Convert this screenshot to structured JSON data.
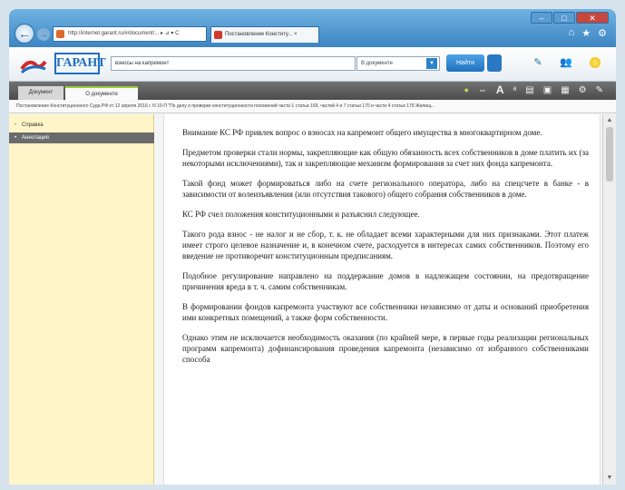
{
  "browser": {
    "address": "http://internet.garant.ru/#/document/... ▸ ⊿ ▾ C",
    "tab_title": "Постановление Конститу... ×",
    "window_controls": [
      "–",
      "□",
      "✕"
    ],
    "icons": [
      "home-icon",
      "star-icon",
      "gear-icon"
    ]
  },
  "toolbar": {
    "logo_text": "ГАРАНТ",
    "search_value": "взносы на капремонт",
    "scope_value": "В документе",
    "find_label": "Найти"
  },
  "doc_tabs": [
    "Документ",
    "О документе"
  ],
  "breadcrumb": "Постановление Конституционного Суда РФ от 12 апреля 2016 г. N 10-П \"По делу о проверке конституционности положений части 1 статьи 169, частей 4 и 7 статьи 170 и части 4 статьи 179 Жилищ...",
  "sidebar": {
    "items": [
      "Справка",
      "Аннотация"
    ]
  },
  "paragraphs": [
    "Внимание КС РФ привлек вопрос о взносах на капремонт общего имущества в многоквартирном доме.",
    "Предметом проверки стали нормы, закрепляющие как общую обязанность всех собственников в доме платить их (за некоторыми исключениями), так и закрепляющие механизм формирования за счет них фонда капремонта.",
    "Такой фонд может формироваться либо на счете регионального оператора, либо на спецсчете в банке - в зависимости от волеизъявления (или отсутствия такового) общего собрания собственников в доме.",
    "КС РФ счел положения конституционными и разъяснил следующее.",
    "Такого рода взнос - не налог и не сбор, т. к. не обладает всеми характерными для них признаками. Этот платеж имеет строго целевое назначение и, в конечном счете, расходуется в интересах самих собственников. Поэтому его введение не противоречит конституционным предписаниям.",
    "Подобное регулирование направлено на поддержание домов в надлежащем состоянии, на предотвращение причинения вреда в т. ч. самим собственникам.",
    "В формировании фондов капремонта участвуют все собственники независимо от даты и оснований приобретения ими конкретных помещений, а также форм собственности.",
    "Однако этим не исключается необходимость оказания (по крайней мере, в первые годы реализации региональных программ капремонта) дофинансирования проведения капремонта (независимо от избранного собственниками способа"
  ]
}
